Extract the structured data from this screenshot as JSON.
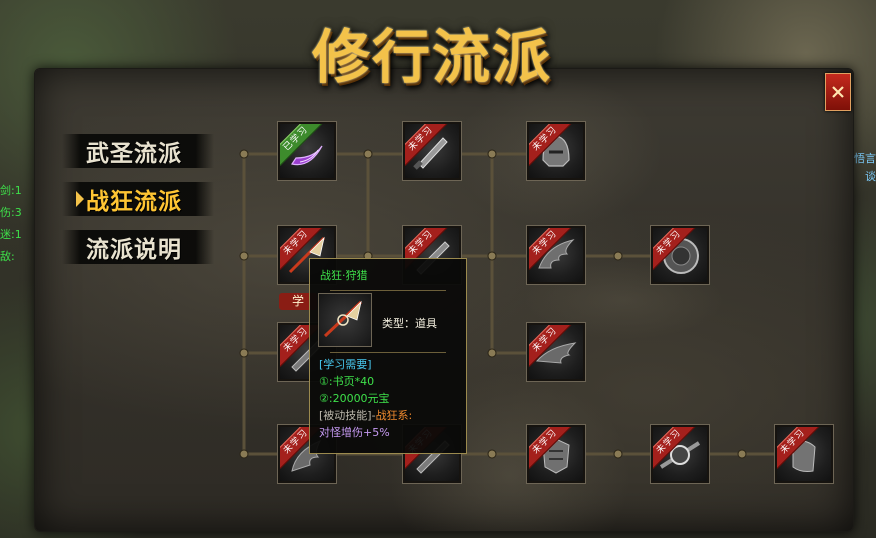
{
  "title": "修行流派",
  "tabs": [
    {
      "label": "武圣流派",
      "active": false
    },
    {
      "label": "战狂流派",
      "active": true
    },
    {
      "label": "流派说明",
      "active": false
    }
  ],
  "ribbons": {
    "learned": "已学习",
    "unlearned": "未学习"
  },
  "learn_button": "学",
  "hud_left": [
    "剑:1",
    "伤:3",
    "迷:1",
    "敌:"
  ],
  "hud_right": [
    "悟言",
    "谈"
  ],
  "tooltip": {
    "title": "战狂·狩猎",
    "type_text": "类型：道具",
    "req_header": "[学习需要]",
    "req_1": "①:书页*40",
    "req_2": "②:20000元宝",
    "passive_label": "[被动技能]-",
    "passive_school": "战狂系:",
    "effect": "对怪增伤+5%"
  },
  "colors": {
    "title_gold": "#f3c24a",
    "tab_active": "#ffc533",
    "ribbon_red": "#a4201c",
    "ribbon_green": "#3d8b2c",
    "tooltip_green": "#3ee04a",
    "tooltip_cyan": "#48c8ee"
  },
  "icons": [
    "close-icon",
    "tab-arrow-icon",
    "purple-crescent-icon",
    "blade-skill-icon",
    "helmet-skill-icon",
    "wing-skill-icon",
    "orb-skill-icon",
    "spear-skill-icon",
    "armor-skill-icon",
    "bracer-skill-icon"
  ]
}
